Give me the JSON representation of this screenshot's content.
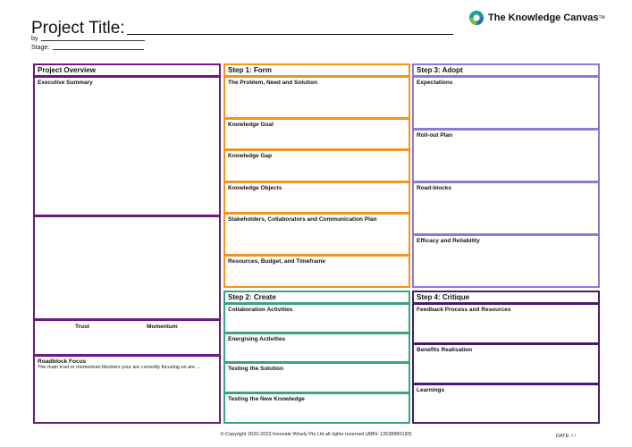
{
  "header": {
    "title": "Project Title:",
    "by_label": "by",
    "stage_label": "Stage:"
  },
  "brand": {
    "name": "The Knowledge Canvas",
    "tm": "TM",
    "logo_icon": "swirl-logo-icon"
  },
  "overview": {
    "header": "Project Overview",
    "exec_summary": "Executive Summary",
    "trust": "Trust",
    "momentum": "Momentum",
    "roadblock_title": "Roadblock Focus",
    "roadblock_desc": "The main trust or momentum blockers your are currently focusing on are ..."
  },
  "step1": {
    "header": "Step 1: Form",
    "sections": [
      "The Problem, Need and Solution",
      "Knowledge Goal",
      "Knowledge Gap",
      "Knowledge Objects",
      "Stakeholders, Collaborators and Communication Plan",
      "Resources, Budget, and Timeframe"
    ]
  },
  "step2": {
    "header": "Step 2: Create",
    "sections": [
      "Collaboration Activities",
      "Energising Activities",
      "Testing the Solution",
      "Testing the New Knowledge"
    ]
  },
  "step3": {
    "header": "Step 3: Adopt",
    "sections": [
      "Expectations",
      "Roll-out Plan",
      "Road-blocks",
      "Efficacy and Reliability"
    ]
  },
  "step4": {
    "header": "Step 4: Critique",
    "sections": [
      "Feedback Process and Resources",
      "Benefits Realisation",
      "Learnings"
    ]
  },
  "footer": {
    "copyright": "© Copyright 2020-2023 Innovate Wisely Pty Ltd all rights reserved (ABN: 12638880183)",
    "date": "DATE:     /     /"
  },
  "colors": {
    "overview": "#6d1a7e",
    "step1": "#f0941e",
    "step2": "#3aa57a",
    "step3": "#8c79d8",
    "step4": "#4a1a70"
  }
}
